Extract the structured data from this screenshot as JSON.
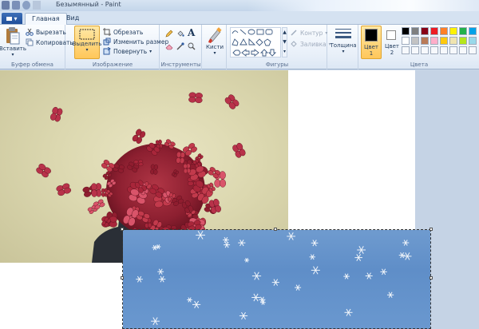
{
  "window": {
    "title": "Безымянный - Paint"
  },
  "tabs": {
    "file_label": "▾",
    "home": "Главная",
    "view": "Вид"
  },
  "clipboard": {
    "paste": "Вставить",
    "cut": "Вырезать",
    "copy": "Копировать",
    "label": "Буфер обмена"
  },
  "image": {
    "select": "Выделить",
    "crop": "Обрезать",
    "resize": "Изменить размер",
    "rotate": "Повернуть",
    "label": "Изображение"
  },
  "tools": {
    "label": "Инструменты"
  },
  "brushes": {
    "label": "Кисти"
  },
  "shapes": {
    "outline": "Контур",
    "fill": "Заливка",
    "label": "Фигуры"
  },
  "size": {
    "label": "Толщина"
  },
  "colors": {
    "color1": "Цвет 1",
    "color2": "Цвет 2",
    "label": "Цвета",
    "color1_value": "#000000",
    "color2_value": "#ffffff",
    "palette_row1": [
      "#000000",
      "#7f7f7f",
      "#880015",
      "#ed1c24",
      "#ff7f27",
      "#fff200",
      "#22b14c",
      "#00a2e8"
    ],
    "palette_row2": [
      "#ffffff",
      "#c3c3c3",
      "#b97a57",
      "#ffaec9",
      "#ffc90e",
      "#efe4b0",
      "#b5e61d",
      "#99d9ea"
    ]
  }
}
